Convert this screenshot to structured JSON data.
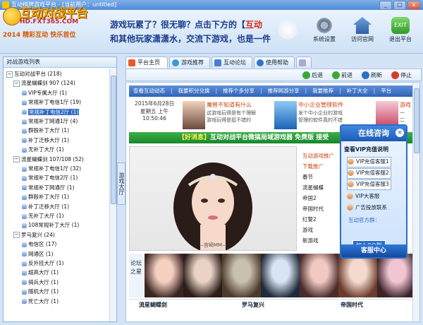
{
  "window": {
    "title": "互动棋牌游戏平台 - [当前用户：untitled]",
    "buttons": [
      "_",
      "□",
      "x"
    ]
  },
  "logo": {
    "main": "互动对战平台",
    "url": "HD.FXT365.COM",
    "slogan": "2014 精彩互动 快乐首位"
  },
  "banner": {
    "line1_a": "游戏玩累了？很无聊？点击下方的【",
    "line1_b": "互动",
    "line2_a": "和其他玩家潇潇水，交流下游戏，也是一件",
    "line2_b": ""
  },
  "toolbar": [
    {
      "label": "系统设置",
      "icon": "settings-icon"
    },
    {
      "label": "访问官网",
      "icon": "home-icon"
    },
    {
      "label": "退出平台",
      "icon": "exit-icon"
    }
  ],
  "sidebar": {
    "title": "对战游戏列表",
    "tree": [
      {
        "text": "互动对战平台 (218)",
        "level": 0,
        "kind": "box",
        "mark": "−"
      },
      {
        "text": "流星蝴蝶剑 907 (124)",
        "level": 1,
        "kind": "box",
        "mark": "−"
      },
      {
        "text": "VIP专属大厅 (1)",
        "level": 2,
        "kind": "dot"
      },
      {
        "text": "常规补丁电信1厅 (19)",
        "level": 2,
        "kind": "dot"
      },
      {
        "text": "常规补丁电信2厅 (1)",
        "level": 2,
        "kind": "dot",
        "selected": true
      },
      {
        "text": "常规补丁网通1厅 (4)",
        "level": 2,
        "kind": "dot"
      },
      {
        "text": "群殴补丁大厅 (1)",
        "level": 2,
        "kind": "dot"
      },
      {
        "text": "补丁迁移大厅 (1)",
        "level": 2,
        "kind": "dot"
      },
      {
        "text": "无补丁大厅 (1)",
        "level": 2,
        "kind": "dot"
      },
      {
        "text": "流星蝴蝶剑 107/108 (52)",
        "level": 1,
        "kind": "box",
        "mark": "−"
      },
      {
        "text": "常规补丁电信1厅 (32)",
        "level": 2,
        "kind": "dot"
      },
      {
        "text": "常规补丁电信2厅 (1)",
        "level": 2,
        "kind": "dot"
      },
      {
        "text": "常规补丁网通厅 (1)",
        "level": 2,
        "kind": "dot"
      },
      {
        "text": "群殴补丁大厅 (1)",
        "level": 2,
        "kind": "dot"
      },
      {
        "text": "补丁迁移大厅 (1)",
        "level": 2,
        "kind": "dot"
      },
      {
        "text": "无补丁大厅 (1)",
        "level": 2,
        "kind": "dot"
      },
      {
        "text": "108常规补丁大厅 (1)",
        "level": 2,
        "kind": "dot"
      },
      {
        "text": "罗马复兴 (24)",
        "level": 1,
        "kind": "box",
        "mark": "−"
      },
      {
        "text": "电信区 (17)",
        "level": 2,
        "kind": "dot"
      },
      {
        "text": "网通区 (1)",
        "level": 2,
        "kind": "dot"
      },
      {
        "text": "反外挂大厅 (1)",
        "level": 2,
        "kind": "dot"
      },
      {
        "text": "超高大厅 (1)",
        "level": 2,
        "kind": "dot"
      },
      {
        "text": "骑兵大厅 (1)",
        "level": 2,
        "kind": "dot"
      },
      {
        "text": "随机大厅 (1)",
        "level": 2,
        "kind": "dot"
      },
      {
        "text": "死亡大厅 (1)",
        "level": 2,
        "kind": "dot"
      }
    ]
  },
  "vertical_tab": "游戏大厅",
  "tabs": [
    {
      "label": "平台主页",
      "active": true
    },
    {
      "label": "游戏推荐"
    },
    {
      "label": "互动论坛"
    },
    {
      "label": "使用帮助"
    },
    {
      "label": ""
    }
  ],
  "nav": {
    "back": "后退",
    "forward": "前进",
    "refresh": "刷新",
    "stop": "停止"
  },
  "content": {
    "toplinks": [
      "查看互动动态",
      "我要积分兑换",
      "推荐个多分享",
      "推荐网游分享",
      "我要推荐",
      "补丁大全",
      "平台"
    ],
    "date": {
      "date": "2015年6月28日",
      "weekday": "星期五 上午",
      "time": "10:50:46"
    },
    "news": [
      {
        "title": "魔兽不知道有什么",
        "line1": "这游戏玩得是有个理解",
        "line2": "游戏玩得是挺不错的"
      },
      {
        "title": "中小企业管理软件",
        "line1": "发个中小企业的游戏",
        "line2": "管理的软件真的不错"
      },
      {
        "title": "游戏",
        "line1": "一",
        "line2": "二"
      }
    ],
    "greenbar_prefix": "【好消息】",
    "greenbar_text": "互动对战平台微搞局域游戏器 免费版 接受",
    "photo_caption": "—宫崎MM—",
    "rightlist": [
      "互动游戏推广",
      "下载推广",
      "春节",
      "流星蝴蝶",
      "帝国2",
      "帝国时代",
      "红警2",
      "游戏",
      "新游戏"
    ],
    "thumbs_label": "论坛之星",
    "bottom_cats": [
      "流星蝴蝶剑",
      "罗马复兴",
      "帝国时代"
    ]
  },
  "popup": {
    "title": "在线咨询",
    "close": "×",
    "subtitle": "查看VIP充值说明",
    "items": [
      "VIP充值客服1",
      "VIP充值客服2",
      "VIP充值客服3",
      "VIP大客服",
      "广告投放联系"
    ],
    "official_group": "互动官方群：",
    "qq_button": "加入QQ群",
    "footer": "客服中心"
  }
}
